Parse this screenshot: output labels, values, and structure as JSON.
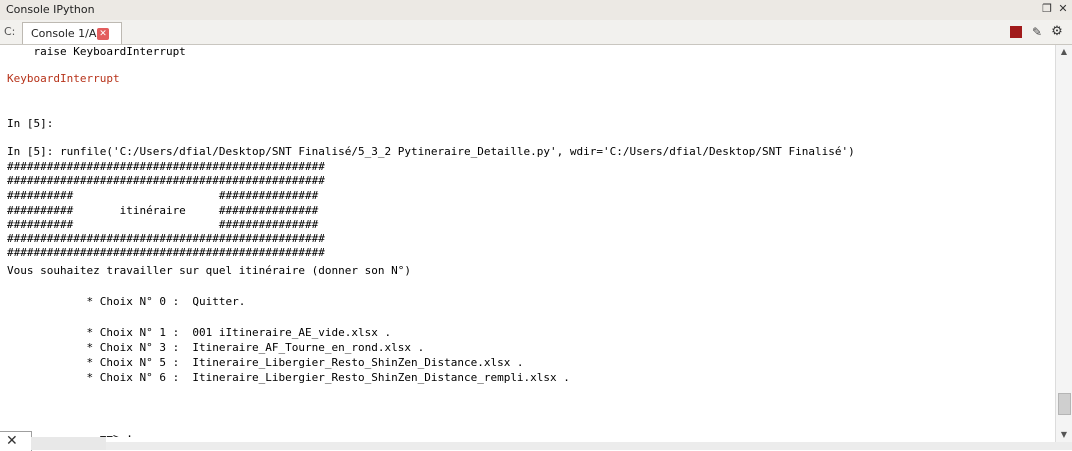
{
  "window": {
    "title": "Console IPython"
  },
  "tab": {
    "label": "Console 1/A",
    "close_glyph": "✕"
  },
  "colors": {
    "error_text": "#b7331a",
    "prompt_text": "#3b7a22",
    "stop_button": "#a11b1b",
    "tab_close": "#e35d5d"
  },
  "console_lines": [
    "    raise KeyboardInterrupt",
    "",
    "KeyboardInterrupt",
    "",
    "",
    "In [5]:",
    "",
    "In [5]: runfile('C:/Users/dfial/Desktop/SNT Finalisé/5_3_2 Pytineraire_Detaille.py', wdir='C:/Users/dfial/Desktop/SNT Finalisé')",
    "################################################",
    "################################################",
    "##########                      ###############",
    "##########       itinéraire     ###############",
    "##########                      ###############",
    "################################################",
    "################################################",
    "Vous souhaitez travailler sur quel itinéraire (donner son N°)",
    "",
    "            * Choix N° 0 :  Quitter.",
    "",
    "            * Choix N° 1 :  001 iItineraire_AE_vide.xlsx .",
    "            * Choix N° 3 :  Itineraire_AF_Tourne_en_rond.xlsx .",
    "            * Choix N° 5 :  Itineraire_Libergier_Resto_ShinZen_Distance.xlsx .",
    "            * Choix N° 6 :  Itineraire_Libergier_Resto_ShinZen_Distance_rempli.xlsx .",
    "",
    "",
    "",
    "              ==> :"
  ],
  "icons": {
    "restore": "restore-icon",
    "close": "close-icon",
    "stop": "stop-icon",
    "clear": "eraser-icon",
    "settings": "gear-icon"
  }
}
